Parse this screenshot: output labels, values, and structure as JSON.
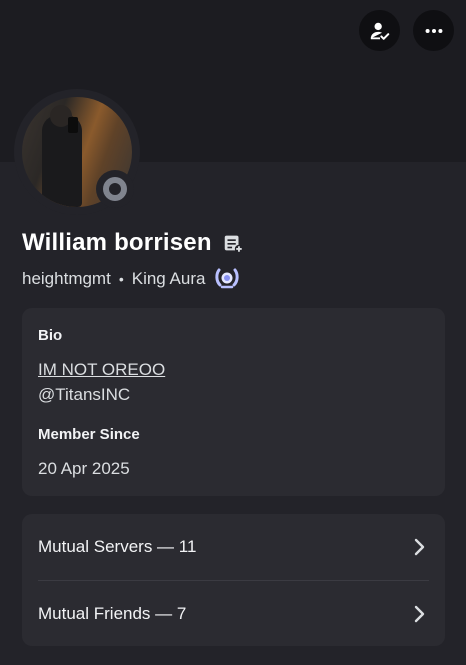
{
  "profile": {
    "display_name": "William borrisen",
    "username": "heightmgmt",
    "separator": "•",
    "tag": "King Aura"
  },
  "bio_card": {
    "bio_label": "Bio",
    "bio_lines": [
      "IM NOT OREOO",
      "@TitansINC"
    ],
    "member_since_label": "Member Since",
    "member_since_value": "20 Apr 2025"
  },
  "mutuals": [
    {
      "label": "Mutual Servers — 11"
    },
    {
      "label": "Mutual Friends — 7"
    }
  ],
  "icons": {
    "friend_action": "person-check-icon",
    "more": "more-horizontal-icon",
    "note": "note-add-icon",
    "badge": "laurel-badge-icon",
    "chevron": "chevron-right-icon",
    "status": "offline-status-icon"
  },
  "colors": {
    "background": "#232329",
    "banner": "#1c1c21",
    "card": "#2b2b31",
    "status_offline": "#80848e",
    "badge": "#b9c0ff"
  }
}
